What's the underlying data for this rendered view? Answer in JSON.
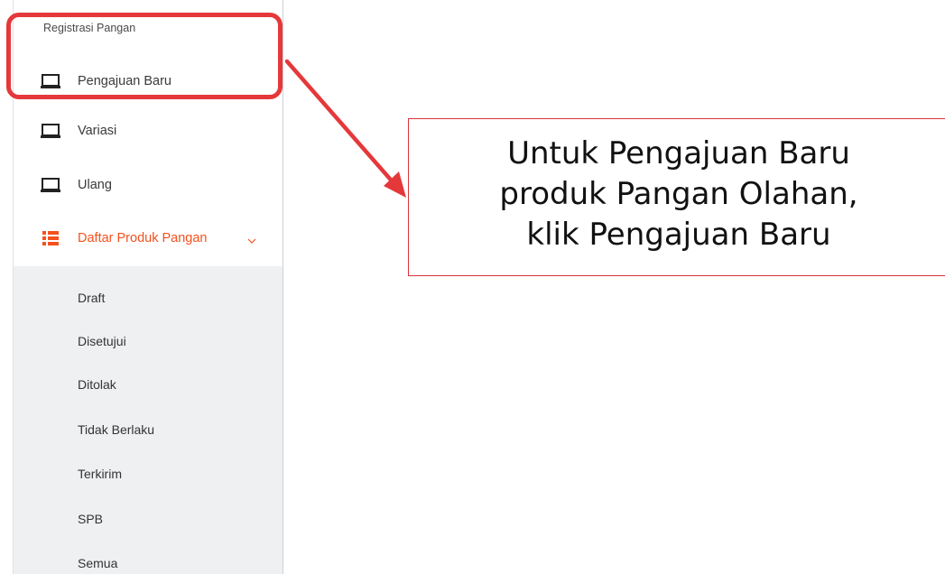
{
  "sidebar": {
    "section_title": "Registrasi Pangan",
    "items": [
      {
        "label": "Pengajuan Baru",
        "icon": "laptop-icon"
      },
      {
        "label": "Variasi",
        "icon": "laptop-icon"
      },
      {
        "label": "Ulang",
        "icon": "laptop-icon"
      },
      {
        "label": "Daftar Produk Pangan",
        "icon": "list-icon",
        "expanded": true
      }
    ],
    "submenu": [
      {
        "label": "Draft"
      },
      {
        "label": "Disetujui"
      },
      {
        "label": "Ditolak"
      },
      {
        "label": "Tidak Berlaku"
      },
      {
        "label": "Terkirim"
      },
      {
        "label": "SPB"
      },
      {
        "label": "Semua"
      }
    ]
  },
  "callout": {
    "line1": "Untuk Pengajuan Baru",
    "line2": "produk Pangan Olahan,",
    "line3": "klik Pengajuan Baru"
  },
  "colors": {
    "accent": "#f4511e",
    "annotation_red": "#e5383b",
    "submenu_bg": "#eef0f1"
  }
}
